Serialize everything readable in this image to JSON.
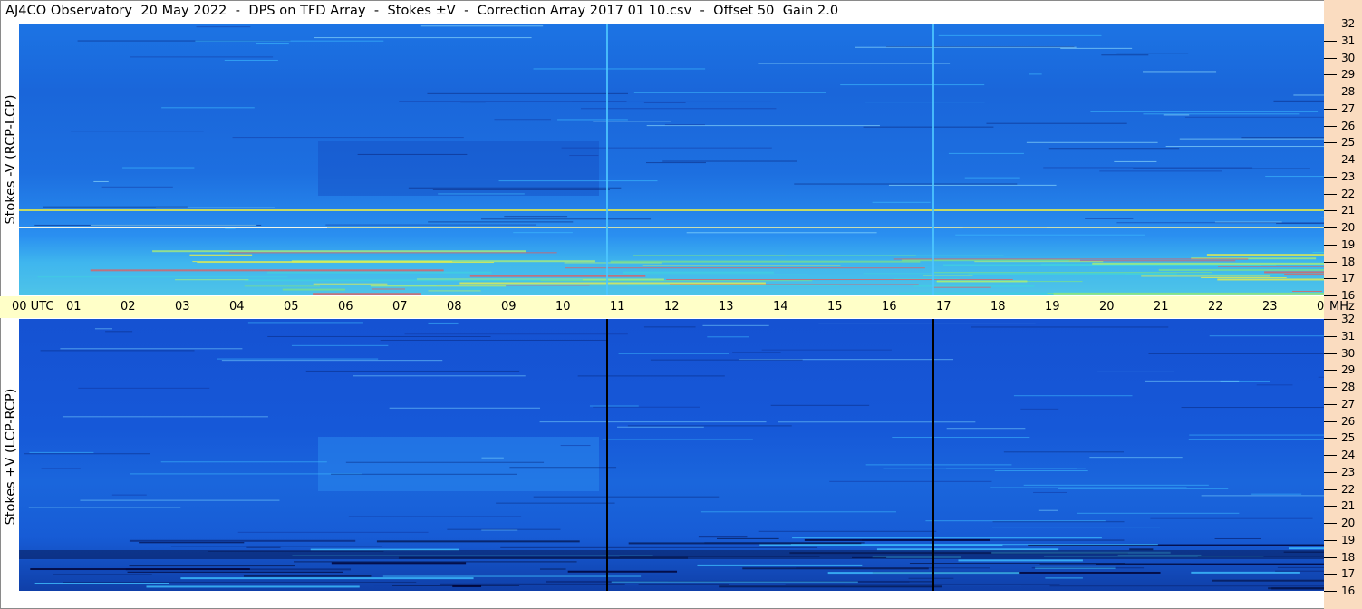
{
  "title": "AJ4CO Observatory  20 May 2022  -  DPS on TFD Array  -  Stokes ±V  -  Correction Array 2017 01 10.csv  -  Offset 50  Gain 2.0",
  "chart_data": {
    "type": "heatmap",
    "panels": [
      {
        "id": "top",
        "ylabel": "Stokes -V (RCP-LCP)",
        "base_color": "#1d6fe0"
      },
      {
        "id": "bottom",
        "ylabel": "Stokes +V (LCP-RCP)",
        "base_color": "#1658d8"
      }
    ],
    "time_axis": {
      "labels": [
        "00 UTC",
        "01",
        "02",
        "03",
        "04",
        "05",
        "06",
        "07",
        "08",
        "09",
        "10",
        "11",
        "12",
        "13",
        "14",
        "15",
        "16",
        "17",
        "18",
        "19",
        "20",
        "21",
        "22",
        "23",
        "00"
      ],
      "range_hours": [
        0,
        24
      ]
    },
    "freq_axis": {
      "unit": "MHz",
      "ticks": [
        32,
        31,
        30,
        29,
        28,
        27,
        26,
        25,
        24,
        23,
        22,
        21,
        20,
        19,
        18,
        17,
        16
      ],
      "range": [
        16,
        32
      ]
    },
    "vertical_markers_utc_hours": [
      10.8,
      16.8
    ]
  },
  "colors": {
    "time_band": "#ffffc8",
    "freq_strip": "#fadcc0",
    "rfi_warm": "#f0f040",
    "rfi_hot": "#e85a5a"
  }
}
